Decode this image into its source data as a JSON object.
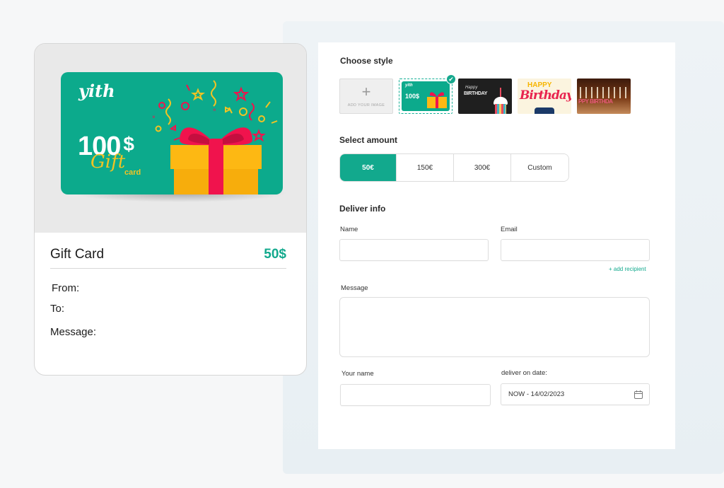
{
  "preview": {
    "card_image": {
      "logo": "yith",
      "amount": "100",
      "currency": "$",
      "script_text": "Gift",
      "subtitle": "card"
    },
    "title": "Gift Card",
    "price": "50$",
    "fields": {
      "from": "From:",
      "to": "To:",
      "message": "Message:"
    }
  },
  "form": {
    "choose_style": {
      "title": "Choose style",
      "add_image_label": "ADD YOUR IMAGE",
      "styles": [
        {
          "name": "Gift card 100$",
          "selected": true
        },
        {
          "name": "Happy Birthday chalkboard cupcake",
          "selected": false
        },
        {
          "name": "Happy Birthday lettering",
          "selected": false
        },
        {
          "name": "Happy Birthday candles",
          "selected": false
        }
      ]
    },
    "select_amount": {
      "title": "Select amount",
      "options": [
        "50€",
        "150€",
        "300€",
        "Custom"
      ],
      "selected": "50€"
    },
    "deliver_info": {
      "title": "Deliver info",
      "name_label": "Name",
      "name_value": "",
      "email_label": "Email",
      "email_value": "",
      "add_recipient": "+ add recipient",
      "message_label": "Message",
      "message_value": "",
      "your_name_label": "Your name",
      "your_name_value": "",
      "date_label": "deliver on date:",
      "date_value": "NOW - 14/02/2023"
    }
  },
  "colors": {
    "accent": "#12a98d",
    "card_green": "#0caa8c",
    "gift_yellow": "#fdb813",
    "ribbon_red": "#f0134d"
  }
}
